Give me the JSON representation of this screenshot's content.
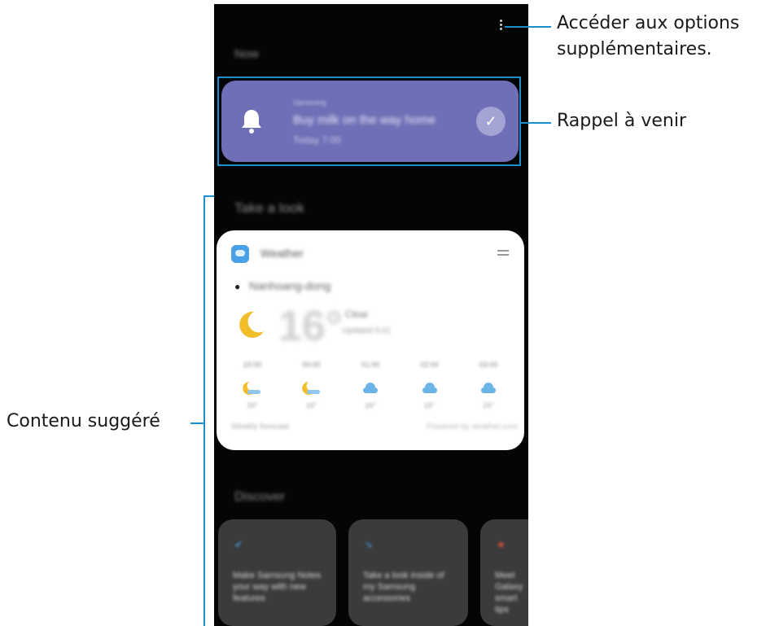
{
  "callouts": {
    "more_options_line1": "Accéder aux options",
    "more_options_line2": "supplémentaires.",
    "upcoming_reminder": "Rappel à venir",
    "suggested_content": "Contenu suggéré"
  },
  "screen": {
    "now_label": "Now",
    "reminder": {
      "eyebrow": "Upcoming",
      "title": "Buy milk on the way home",
      "time": "Today 7:00"
    },
    "take_a_look_label": "Take a look",
    "weather": {
      "app_name": "Weather",
      "location": "Nanhoang-dong",
      "temperature": "16°",
      "condition": "Clear",
      "updated": "Updated 6:41",
      "forecast": [
        {
          "time": "23:00",
          "icon": "moon-cloud-icon",
          "temp": "16°"
        },
        {
          "time": "00:00",
          "icon": "moon-cloud-icon",
          "temp": "16°"
        },
        {
          "time": "01:00",
          "icon": "cloud-icon",
          "temp": "16°"
        },
        {
          "time": "02:00",
          "icon": "cloud-icon",
          "temp": "15°"
        },
        {
          "time": "03:00",
          "icon": "cloud-icon",
          "temp": "15°"
        }
      ],
      "footer_left": "Weekly forecast",
      "footer_right": "Powered by weather.com"
    },
    "discover_label": "Discover",
    "discover_cards": [
      {
        "icon": "check-icon",
        "text": "Make Samsung Notes your way with new features"
      },
      {
        "icon": "arrow-icon",
        "text": "Take a look inside of my Samsung accessories"
      },
      {
        "icon": "star-icon",
        "text": "Meet Galaxy smart tips"
      }
    ]
  },
  "colors": {
    "reminder_card": "#6e6fb6",
    "callout_line": "#1a8fd0",
    "screen_bg": "#050505"
  }
}
